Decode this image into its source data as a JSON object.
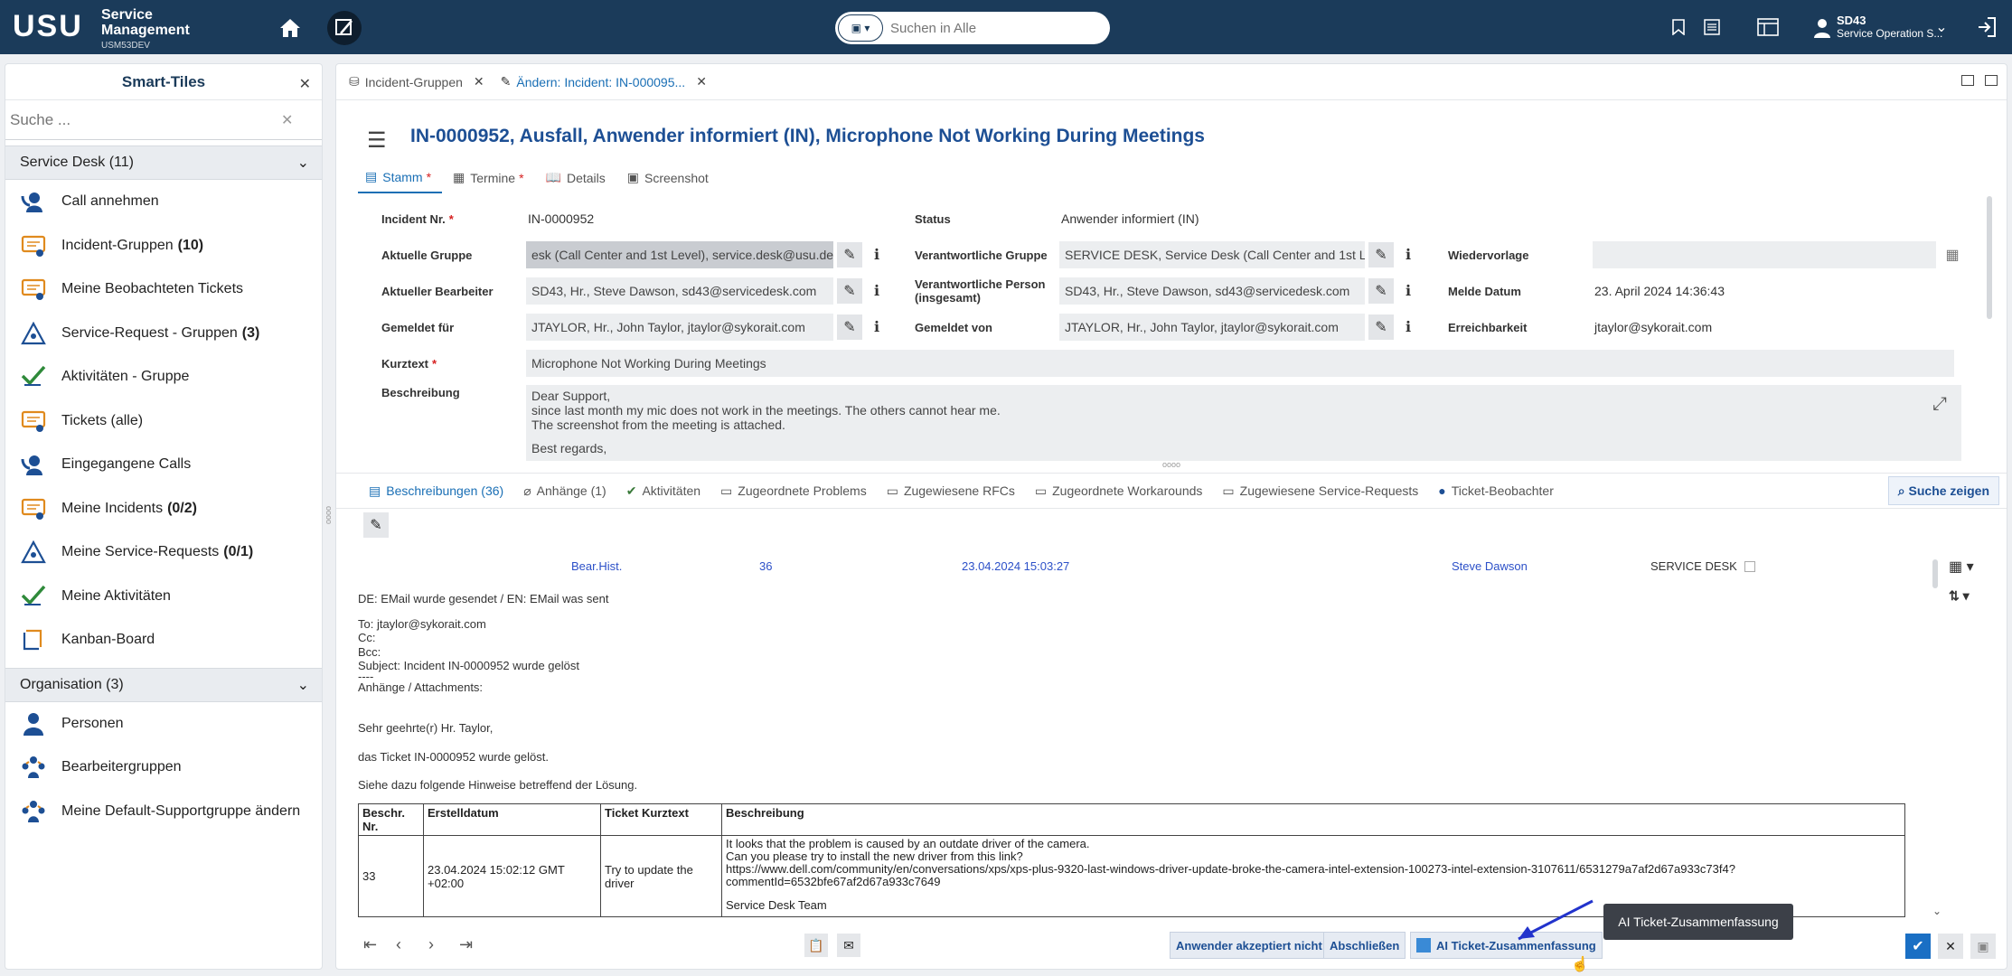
{
  "header": {
    "logo": "USU",
    "brand_line1": "Service",
    "brand_line2": "Management",
    "brand_sub": "USM53DEV",
    "search_placeholder": "Suchen in Alle",
    "user_name": "SD43",
    "user_role": "Service Operation S..."
  },
  "sidebar": {
    "title": "Smart-Tiles",
    "search_placeholder": "Suche ...",
    "group1": "Service Desk (11)",
    "items": [
      {
        "label": "Call annehmen",
        "count": ""
      },
      {
        "label": "Incident-Gruppen",
        "count": "(10)"
      },
      {
        "label": "Meine Beobachteten Tickets",
        "count": ""
      },
      {
        "label": "Service-Request - Gruppen",
        "count": "(3)"
      },
      {
        "label": "Aktivitäten - Gruppe",
        "count": ""
      },
      {
        "label": "Tickets (alle)",
        "count": ""
      },
      {
        "label": "Eingegangene Calls",
        "count": ""
      },
      {
        "label": "Meine Incidents",
        "count": "(0/2)"
      },
      {
        "label": "Meine Service-Requests",
        "count": "(0/1)"
      },
      {
        "label": "Meine Aktivitäten",
        "count": ""
      },
      {
        "label": "Kanban-Board",
        "count": ""
      }
    ],
    "group2": "Organisation (3)",
    "items2": [
      {
        "label": "Personen"
      },
      {
        "label": "Bearbeitergruppen"
      },
      {
        "label": "Meine Default-Supportgruppe ändern"
      }
    ]
  },
  "tabs": {
    "tab1": "Incident-Gruppen",
    "tab2": "Ändern: Incident: IN-000095..."
  },
  "ticket": {
    "title": "IN-0000952, Ausfall, Anwender informiert (IN), Microphone Not Working During Meetings",
    "subtabs": [
      "Stamm",
      "Termine",
      "Details",
      "Screenshot"
    ],
    "req_mark": "*",
    "labels": {
      "incident_nr": "Incident Nr.",
      "aktuelle_gruppe": "Aktuelle Gruppe",
      "aktueller_bearbeiter": "Aktueller Bearbeiter",
      "gemeldet_fuer": "Gemeldet für",
      "kurztext": "Kurztext",
      "beschreibung": "Beschreibung",
      "status": "Status",
      "verantwortliche_gruppe": "Verantwortliche Gruppe",
      "verantwortliche_person": "Verantwortliche Person (insgesamt)",
      "gemeldet_von": "Gemeldet von",
      "wiedervorlage": "Wiedervorlage",
      "melde_datum": "Melde Datum",
      "erreichbarkeit": "Erreichbarkeit"
    },
    "values": {
      "incident_nr": "IN-0000952",
      "aktuelle_gruppe": "esk (Call Center and 1st Level), service.desk@usu.de",
      "aktueller_bearbeiter": "SD43, Hr., Steve Dawson, sd43@servicedesk.com",
      "gemeldet_fuer": "JTAYLOR, Hr., John Taylor, jtaylor@sykorait.com",
      "kurztext": "Microphone Not Working During Meetings",
      "status": "Anwender informiert (IN)",
      "verantwortliche_gruppe": "SERVICE DESK, Service Desk (Call Center and 1st L...",
      "verantwortliche_person": "SD43, Hr., Steve Dawson, sd43@servicedesk.com",
      "gemeldet_von": "JTAYLOR, Hr., John Taylor, jtaylor@sykorait.com",
      "melde_datum": "23. April 2024 14:36:43",
      "erreichbarkeit": "jtaylor@sykorait.com",
      "desc1": "Dear Support,",
      "desc2": "since last month my mic does not work in the meetings. The others cannot hear me.",
      "desc3": "The screenshot from the meeting is attached.",
      "desc4": "Best regards,"
    }
  },
  "bottom_tabs": [
    "Beschreibungen (36)",
    "Anhänge (1)",
    "Aktivitäten",
    "Zugeordnete Problems",
    "Zugewiesene RFCs",
    "Zugeordnete Workarounds",
    "Zugewiesene Service-Requests",
    "Ticket-Beobachter"
  ],
  "search_show": "Suche zeigen",
  "history": {
    "type": "Bear.Hist.",
    "num": "36",
    "date": "23.04.2024 15:03:27",
    "user": "Steve Dawson",
    "group": "SERVICE DESK"
  },
  "mail": {
    "l1": "DE: EMail wurde gesendet / EN: EMail was sent",
    "l2": "To: jtaylor@sykorait.com",
    "l3": "Cc:",
    "l4": "Bcc:",
    "l5": "Subject: Incident IN-0000952 wurde gelöst",
    "l6": "----",
    "l7": "Anhänge / Attachments:",
    "l8": "Sehr geehrte(r) Hr. Taylor,",
    "l9": "das Ticket IN-0000952 wurde gelöst.",
    "l10": "Siehe dazu folgende Hinweise betreffend der Lösung."
  },
  "table": {
    "headers": [
      "Beschr. Nr.",
      "Erstelldatum",
      "Ticket Kurztext",
      "Beschreibung"
    ],
    "row": {
      "nr": "33",
      "date": "23.04.2024 15:02:12 GMT +02:00",
      "short": "Try to update the driver",
      "d1": "It looks that the problem is caused by an outdate driver of the camera.",
      "d2": "Can you please try to install the new driver from this link?",
      "d3": "https://www.dell.com/community/en/conversations/xps/xps-plus-9320-last-windows-driver-update-broke-the-camera-intel-extension-100273-intel-extension-3107611/6531279a7af2d67a933c73f4?",
      "d4": "commentId=6532bfe67af2d67a933c7649",
      "d5": "Service Desk Team"
    }
  },
  "footer": {
    "btn1": "Anwender akzeptiert nicht",
    "btn2": "Abschließen",
    "btn3": "AI Ticket-Zusammenfassung",
    "tooltip": "AI Ticket-Zusammenfassung"
  }
}
